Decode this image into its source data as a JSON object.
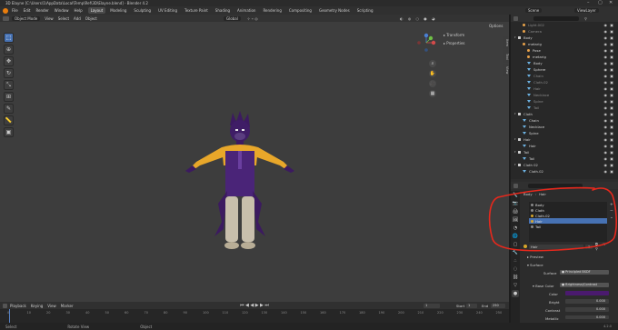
{
  "title_bar": {
    "title": "3D Elayne [C:\\Users\\1\\AppData\\Local\\Temp\\Ref\\3D\\Elayne.blend] - Blender 4.2",
    "controls": [
      "–",
      "▢",
      "✕"
    ]
  },
  "menu": {
    "items": [
      "File",
      "Edit",
      "Render",
      "Window",
      "Help"
    ],
    "workspaces": [
      "Layout",
      "Modeling",
      "Sculpting",
      "UV Editing",
      "Texture Paint",
      "Shading",
      "Animation",
      "Rendering",
      "Compositing",
      "Geometry Nodes",
      "Scripting"
    ],
    "active_workspace": "Layout",
    "scene_label": "Scene",
    "view_layer_label": "ViewLayer"
  },
  "viewport": {
    "mode": "Object Mode",
    "header_items": [
      "View",
      "Select",
      "Add",
      "Object"
    ],
    "orientation": "Global",
    "options_label": "Options",
    "npanel": {
      "transform": "Transform",
      "properties": "Properties"
    },
    "side_tabs": [
      "Item",
      "Tool",
      "View"
    ],
    "background_color": "#3d3d3d"
  },
  "toolbar": {
    "tools": [
      "cursor-select-icon",
      "cursor-icon",
      "move-icon",
      "rotate-icon",
      "scale-icon",
      "transform-icon",
      "annotate-icon",
      "measure-icon",
      "add-cube-icon"
    ]
  },
  "timeline": {
    "header": [
      "Playback",
      "Keying",
      "View",
      "Marker"
    ],
    "current_frame": "1",
    "start_label": "Start",
    "start_value": "1",
    "end_label": "End",
    "end_value": "250",
    "ticks": [
      "0",
      "10",
      "20",
      "30",
      "40",
      "50",
      "60",
      "70",
      "80",
      "90",
      "100",
      "110",
      "120",
      "130",
      "140",
      "150",
      "160",
      "170",
      "180",
      "190",
      "200",
      "210",
      "220",
      "230",
      "240",
      "250"
    ]
  },
  "status_bar": {
    "items": [
      "Select",
      "Rotate View",
      "Object"
    ],
    "version": "4.2.0"
  },
  "outliner": {
    "rows": [
      {
        "name": "Light.002",
        "type": "obj",
        "depth": 1,
        "dim": true
      },
      {
        "name": "Camera",
        "type": "obj",
        "depth": 1,
        "dim": true
      },
      {
        "name": "Body",
        "type": "coll",
        "depth": 0
      },
      {
        "name": "metarig",
        "type": "obj",
        "depth": 1
      },
      {
        "name": "Pose",
        "type": "obj",
        "depth": 2
      },
      {
        "name": "metarig",
        "type": "obj",
        "depth": 2
      },
      {
        "name": "Body",
        "type": "mesh",
        "depth": 2
      },
      {
        "name": "Sphere",
        "type": "mesh",
        "depth": 2
      },
      {
        "name": "Chain",
        "type": "mesh",
        "depth": 2,
        "dim": true
      },
      {
        "name": "Cloth.02",
        "type": "mesh",
        "depth": 2,
        "dim": true
      },
      {
        "name": "Hair",
        "type": "mesh",
        "depth": 2,
        "dim": true
      },
      {
        "name": "Necklace",
        "type": "mesh",
        "depth": 2,
        "dim": true
      },
      {
        "name": "Spine",
        "type": "mesh",
        "depth": 2,
        "dim": true
      },
      {
        "name": "Tail",
        "type": "mesh",
        "depth": 2,
        "dim": true
      },
      {
        "name": "Cloth",
        "type": "coll",
        "depth": 0
      },
      {
        "name": "Chain",
        "type": "mesh",
        "depth": 1
      },
      {
        "name": "Necklace",
        "type": "mesh",
        "depth": 1
      },
      {
        "name": "Spine",
        "type": "mesh",
        "depth": 1
      },
      {
        "name": "Hair",
        "type": "coll",
        "depth": 0
      },
      {
        "name": "Hair",
        "type": "mesh",
        "depth": 1
      },
      {
        "name": "Tail",
        "type": "coll",
        "depth": 0
      },
      {
        "name": "Tail",
        "type": "mesh",
        "depth": 1
      },
      {
        "name": "Cloth 02",
        "type": "coll",
        "depth": 0
      },
      {
        "name": "Cloth.02",
        "type": "mesh",
        "depth": 1
      }
    ]
  },
  "properties": {
    "breadcrumb_object": "Body",
    "breadcrumb_material": "Hair",
    "materials": [
      {
        "name": "Body",
        "color": "#8a8a8a"
      },
      {
        "name": "Cloth",
        "color": "#8a8a8a"
      },
      {
        "name": "Cloth.02",
        "color": "#d6a52a"
      },
      {
        "name": "Hair",
        "color": "#d6a52a",
        "selected": true
      },
      {
        "name": "Tail",
        "color": "#8a8a8a"
      }
    ],
    "material_name": "Hair",
    "user_count": "3",
    "preview_label": "Preview",
    "surface_label": "Surface",
    "surface_field_label": "Surface",
    "surface_value": "Principled BSDF",
    "base_color_label": "Base Color",
    "base_color_value": "Brightness/Contrast",
    "color_label": "Color",
    "color_swatch": "#4a1a6e",
    "bright_label": "Bright",
    "bright_value": "0.000",
    "contrast_label": "Contrast",
    "contrast_value": "0.000",
    "metallic_label": "Metallic",
    "metallic_value": "0.000"
  },
  "annotation_color": "#e8281c"
}
